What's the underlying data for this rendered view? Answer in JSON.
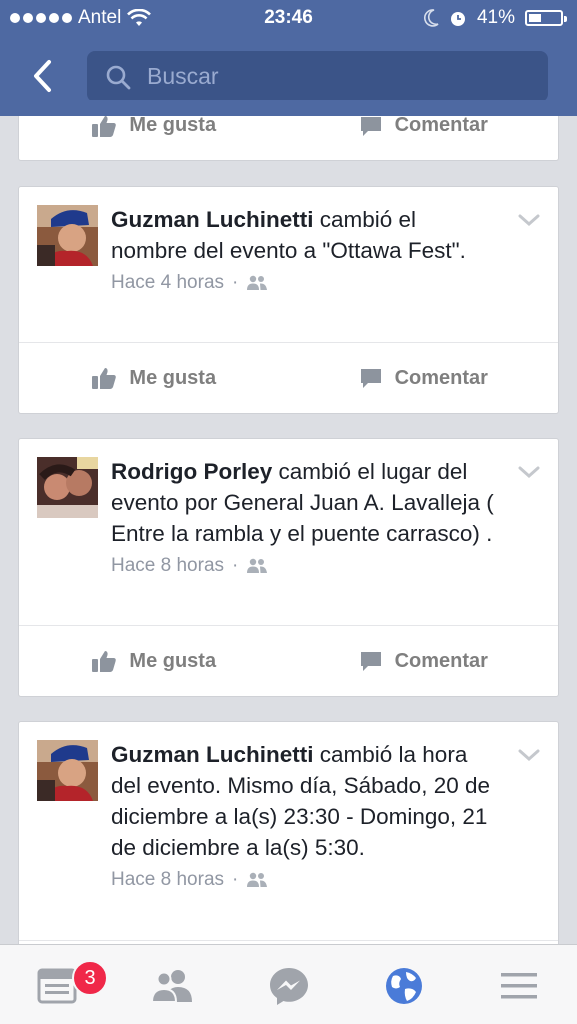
{
  "status_bar": {
    "carrier": "Antel",
    "time": "23:46",
    "battery": "41%",
    "battery_level": 0.41
  },
  "header": {
    "search_placeholder": "Buscar"
  },
  "actions": {
    "like": "Me gusta",
    "comment": "Comentar"
  },
  "posts": [
    {
      "author": "Guzman Luchinetti",
      "text": " cambió el nombre del evento a \"Ottawa Fest\".",
      "time": "Hace 4 horas"
    },
    {
      "author": "Rodrigo Porley",
      "text": " cambió el lugar del evento por General Juan A. Lavalleja ( Entre la rambla y el puente carrasco) .",
      "time": "Hace 8 horas"
    },
    {
      "author": "Guzman Luchinetti",
      "text": " cambió la hora del evento. Mismo día, Sábado, 20 de diciembre a la(s) 23:30 - Domingo, 21 de diciembre a la(s) 5:30.",
      "time": "Hace 8 horas"
    }
  ],
  "tabbar": {
    "badge": "3"
  },
  "colors": {
    "brand": "#4e69a2",
    "search_bg": "#3b5488",
    "badge": "#f02849",
    "active_tab": "#4a7bd8",
    "inactive_tab": "#a0a4ab"
  },
  "icons": {
    "news_feed": "news-feed-icon",
    "friends": "friends-icon",
    "messenger": "messenger-icon",
    "globe": "globe-icon",
    "more": "menu-icon"
  }
}
